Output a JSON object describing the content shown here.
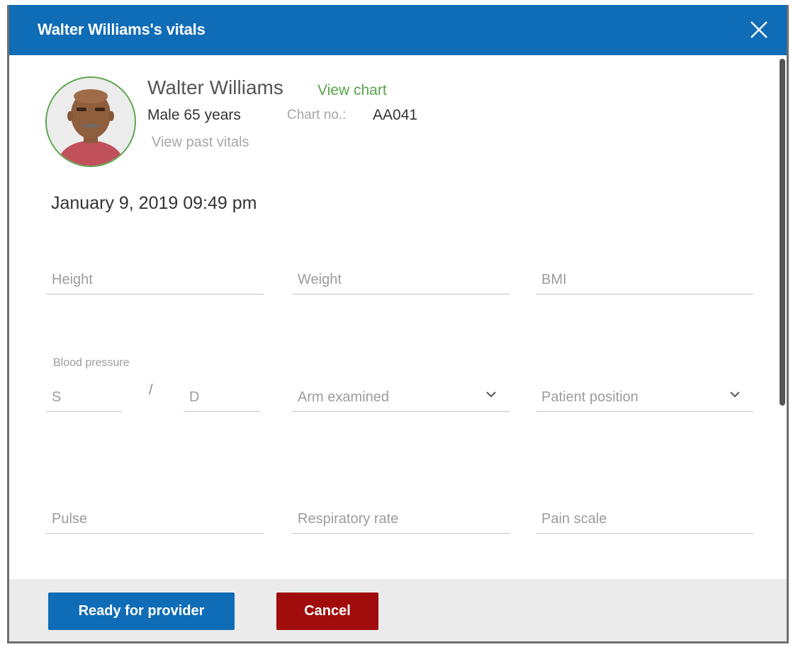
{
  "dialog": {
    "title": "Walter Williams's vitals"
  },
  "patient": {
    "name": "Walter Williams",
    "view_chart_label": "View chart",
    "gender": "Male",
    "age": "65 years",
    "chart_no_label": "Chart no.:",
    "chart_no_value": "AA041",
    "view_past_vitals_label": "View past vitals",
    "avatar_icon": "patient-avatar"
  },
  "recorded_at": "January 9, 2019 09:49 pm",
  "fields": {
    "height": {
      "placeholder": "Height"
    },
    "weight": {
      "placeholder": "Weight"
    },
    "bmi": {
      "placeholder": "BMI"
    },
    "blood_pressure_label": "Blood pressure",
    "systolic": {
      "placeholder": "S"
    },
    "separator": "/",
    "diastolic": {
      "placeholder": "D"
    },
    "arm_examined": {
      "placeholder": "Arm examined"
    },
    "patient_position": {
      "placeholder": "Patient position"
    },
    "pulse": {
      "placeholder": "Pulse"
    },
    "respiratory_rate": {
      "placeholder": "Respiratory rate"
    },
    "pain_scale": {
      "placeholder": "Pain scale"
    }
  },
  "footer": {
    "ready_label": "Ready for provider",
    "cancel_label": "Cancel"
  },
  "colors": {
    "header_blue": "#0f6cb6",
    "cancel_red": "#a00c0c",
    "accent_green": "#5aa34a"
  }
}
